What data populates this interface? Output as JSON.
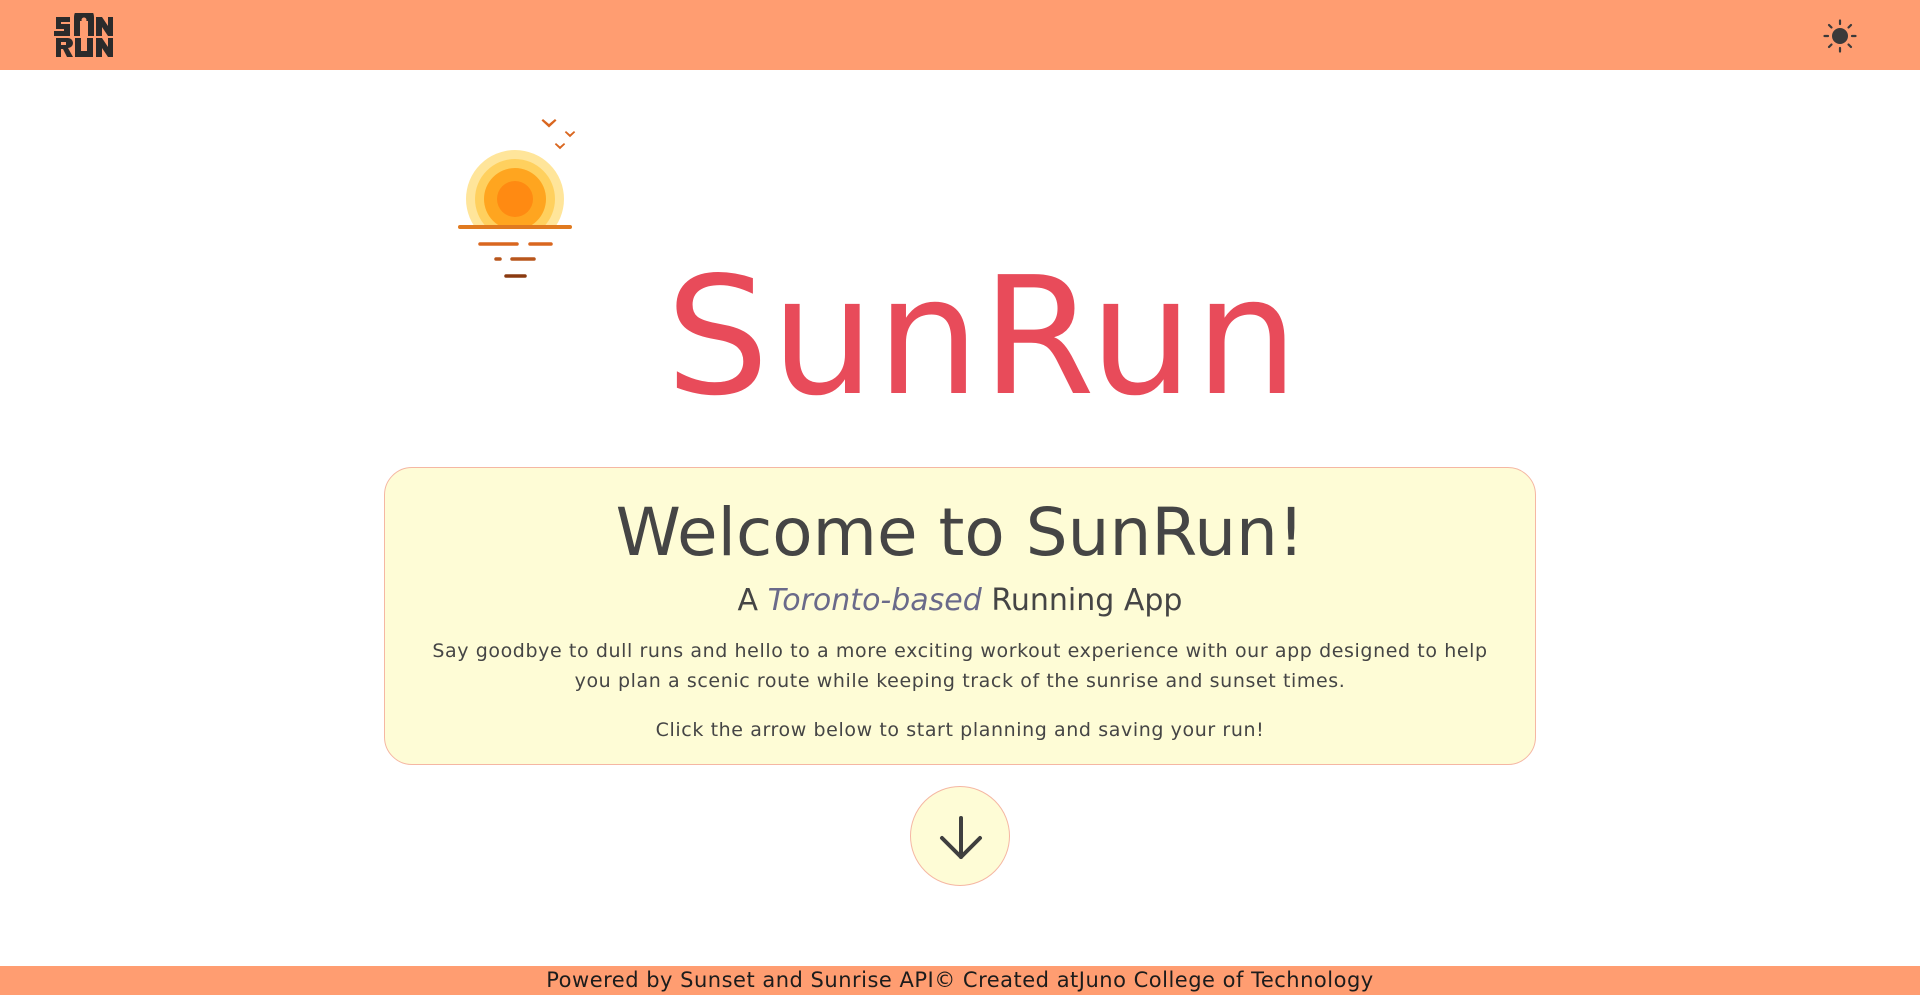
{
  "header": {
    "logo_alt": "SunRun logo",
    "logo_icon": "sunrun-logo-icon",
    "theme_toggle_icon": "sun-icon",
    "theme_toggle_label": "Toggle theme"
  },
  "hero": {
    "illustration_icon": "sunset-illustration-icon",
    "title": "SunRun"
  },
  "welcome": {
    "heading": "Welcome to SunRun!",
    "tagline_prefix": "A",
    "tagline_city": "Toronto-based",
    "tagline_suffix": "Running App",
    "description": "Say goodbye to dull runs and hello to a more exciting workout experience with our app designed to help you plan a scenic route while keeping track of the sunrise and sunset times.",
    "cta": "Click the arrow below to start planning and saving your run!"
  },
  "scroll_button": {
    "icon": "arrow-down-icon",
    "label": "Scroll down"
  },
  "footer": {
    "text": "Powered by Sunset and Sunrise API© Created atJuno College of Technology"
  },
  "colors": {
    "header_bg": "#ff9d71",
    "title": "#e84b5a",
    "card_bg": "#fefcd6",
    "card_border": "#f5b7a3",
    "text": "#454545"
  }
}
